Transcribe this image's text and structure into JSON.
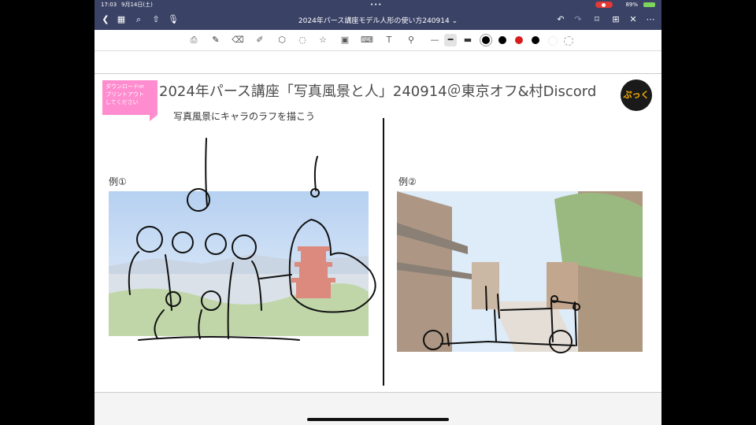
{
  "status_bar": {
    "time": "17:03",
    "date": "9月14日(土)",
    "battery": "89%"
  },
  "nav": {
    "title": "2024年パース講座モデル人形の使い方240914 ⌄"
  },
  "page": {
    "tag_text": "ダウンロードor\nプリントアウト\nしてください",
    "heading": "2024年パース講座「写真風景と人」240914＠東京オフ&村Discord",
    "subheading": "写真風景にキャラのラフを描こう",
    "logo_text": "ぷっく",
    "example1_label": "例①",
    "example2_label": "例②"
  },
  "colors": {
    "nav_bg": "#3a4266",
    "tag_pink": "#ff8ccf",
    "record_red": "#e53935",
    "ink_red": "#c62828"
  }
}
